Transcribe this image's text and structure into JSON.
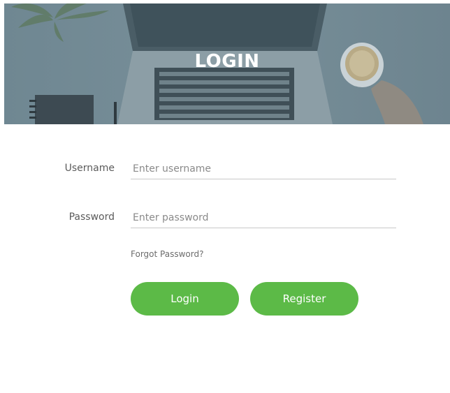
{
  "header": {
    "title": "LOGIN"
  },
  "form": {
    "username_label": "Username",
    "username_placeholder": "Enter username",
    "password_label": "Password",
    "password_placeholder": "Enter password",
    "forgot_link": "Forgot Password?",
    "login_button": "Login",
    "register_button": "Register"
  },
  "colors": {
    "accent": "#5cba47",
    "hero_overlay": "#788f99"
  }
}
